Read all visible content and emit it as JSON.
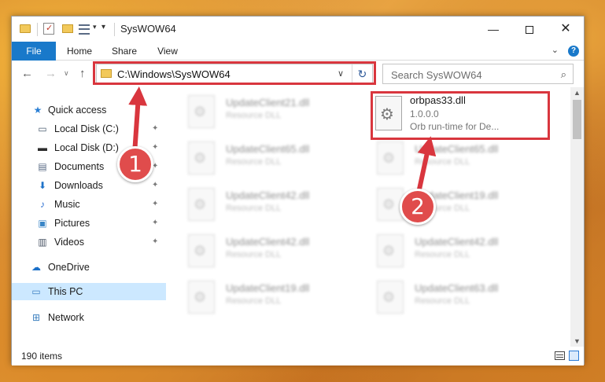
{
  "window": {
    "title": "SysWOW64",
    "min_glyph": "—",
    "close_glyph": "✕"
  },
  "ribbon": {
    "tabs": [
      "File",
      "Home",
      "Share",
      "View"
    ],
    "expand_glyph": "⌄",
    "help_glyph": "?"
  },
  "nav": {
    "back_glyph": "←",
    "forward_glyph": "→",
    "recent_glyph": "∨",
    "up_glyph": "↑"
  },
  "address": {
    "path": "C:\\Windows\\SysWOW64",
    "dropdown_glyph": "∨",
    "refresh_glyph": "↻"
  },
  "search": {
    "placeholder": "Search SysWOW64",
    "icon_glyph": "⌕"
  },
  "sidebar": {
    "items": [
      {
        "label": "Quick access",
        "icon": "★",
        "pinned": false
      },
      {
        "label": "Local Disk (C:)",
        "icon": "▭",
        "pinned": true
      },
      {
        "label": "Local Disk (D:)",
        "icon": "▬",
        "pinned": true
      },
      {
        "label": "Documents",
        "icon": "▤",
        "pinned": true
      },
      {
        "label": "Downloads",
        "icon": "⬇",
        "pinned": true
      },
      {
        "label": "Music",
        "icon": "♪",
        "pinned": true
      },
      {
        "label": "Pictures",
        "icon": "▣",
        "pinned": true
      },
      {
        "label": "Videos",
        "icon": "▥",
        "pinned": true
      },
      {
        "label": "OneDrive",
        "icon": "☁",
        "pinned": false
      },
      {
        "label": "This PC",
        "icon": "▭",
        "pinned": false,
        "selected": true
      },
      {
        "label": "Network",
        "icon": "⊞",
        "pinned": false
      }
    ],
    "pin_glyph": "✦"
  },
  "files": {
    "left_column": [
      {
        "name": "UpdateClient21.dll",
        "desc": "Resource DLL"
      },
      {
        "name": "UpdateClient65.dll",
        "desc": "Resource DLL"
      },
      {
        "name": "UpdateClient42.dll",
        "desc": "Resource DLL"
      },
      {
        "name": "UpdateClient42.dll",
        "desc": "Resource DLL"
      },
      {
        "name": "UpdateClient19.dll",
        "desc": "Resource DLL"
      }
    ],
    "right_column": [
      {
        "name": "UpdateClient65.dll",
        "desc": "Resource DLL"
      },
      {
        "name": "UpdateClient19.dll",
        "desc": "Resource DLL"
      },
      {
        "name": "UpdateClient42.dll",
        "desc": "Resource DLL"
      },
      {
        "name": "UpdateClient63.dll",
        "desc": "Resource DLL"
      }
    ],
    "highlighted": {
      "name": "orbpas33.dll",
      "version": "1.0.0.0",
      "desc": "Orb run-time for De..."
    }
  },
  "status": {
    "item_count": "190 items"
  },
  "scrollbar": {
    "up_glyph": "▲",
    "down_glyph": "▼"
  },
  "annotations": {
    "step1": "1",
    "step2": "2",
    "color": "#d9363e"
  }
}
